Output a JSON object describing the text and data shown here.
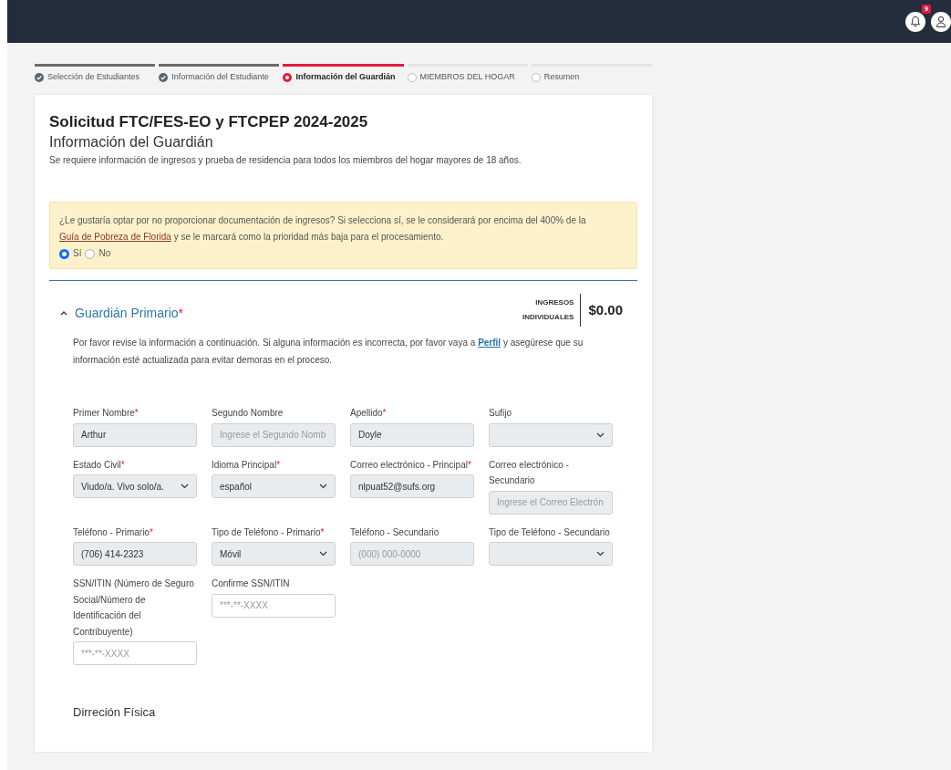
{
  "header": {
    "notification_count": "9"
  },
  "steps": [
    {
      "label": "Selección de Estudiantes",
      "completed": true,
      "selected": false
    },
    {
      "label": "Información del Estudiante",
      "completed": true,
      "selected": false
    },
    {
      "label": "Información del Guardián",
      "completed": false,
      "selected": true
    },
    {
      "label": "MIEMBROS DEL HOGAR",
      "completed": false,
      "selected": false
    },
    {
      "label": "Resumen",
      "completed": false,
      "selected": false
    }
  ],
  "form": {
    "title": "Solicitud FTC/FES-EO y FTCPEP 2024-2025",
    "subtitle": "Información del Guardián",
    "intro": "Se requiere información de ingresos y prueba de residencia para todos los miembros del hogar mayores de 18 años."
  },
  "alert": {
    "text_before": "¿Le gustaría optar por no proporcionar documentación de ingresos? Si selecciona sí, se le considerará por encima del 400% de la ",
    "link": "Guía de Pobreza de Florida",
    "text_after": " y se le marcará como la prioridad más baja para el procesamiento.",
    "options": [
      {
        "label": "Sí",
        "selected": true
      },
      {
        "label": "No",
        "selected": false
      }
    ]
  },
  "section": {
    "title": "Guardián Primario",
    "required_mark": "*",
    "expanded": true,
    "income_label": "INGRESOS INDIVIDUALES",
    "income_value": "$0.00",
    "notice_before": "Por favor revise la información a continuación. Si alguna información es incorrecta, por favor vaya a ",
    "notice_link": "Perfil",
    "notice_after": " y asegúrese que su información esté actualizada para evitar demoras en el proceso.",
    "field_rows": [
      [
        {
          "label": "Primer Nombre",
          "required_mark": "*",
          "kind": "text",
          "value": "Arthur",
          "disabled": true
        },
        {
          "label": "Segundo Nombre",
          "kind": "text",
          "placeholder": "Ingrese el Segundo Nomb",
          "disabled": true
        },
        {
          "label": "Apellido",
          "required_mark": "*",
          "kind": "text",
          "value": "Doyle",
          "disabled": true
        },
        {
          "label": "Sufijo",
          "kind": "select",
          "disabled": true
        }
      ],
      [
        {
          "label": "Estado Civil",
          "required_mark": "*",
          "kind": "select",
          "value": "Viudo/a. Vivo solo/a.",
          "disabled": true
        },
        {
          "label": "Idioma Principal",
          "required_mark": "*",
          "kind": "select",
          "value": "español",
          "disabled": true
        },
        {
          "label": "Correo electrónico - Principal",
          "required_mark": "*",
          "kind": "text",
          "value": "nlpuat52@sufs.org",
          "disabled": true
        },
        {
          "label": "Correo electrónico - Secundario",
          "kind": "text",
          "placeholder": "Ingrese el Correo Electrón",
          "disabled": true
        }
      ],
      [
        {
          "label": "Teléfono - Primario",
          "required_mark": "*",
          "kind": "text",
          "value": "(706) 414-2323",
          "disabled": true
        },
        {
          "label": "Tipo de Teléfono - Primario",
          "required_mark": "*",
          "kind": "select",
          "value": "Móvil",
          "disabled": true
        },
        {
          "label": "Teléfono - Secundario",
          "kind": "text",
          "placeholder": "(000) 000-0000",
          "disabled": true
        },
        {
          "label": "Tipo de Teléfono - Secundario",
          "kind": "select",
          "disabled": true
        }
      ],
      [
        {
          "label": "SSN/ITIN (Número de Seguro Social/Número de Identificación del Contribuyente)",
          "kind": "text",
          "placeholder": "***-**-XXXX",
          "disabled": false
        },
        {
          "label": "Confirme SSN/ITIN",
          "kind": "text",
          "placeholder": "***-**-XXXX",
          "disabled": false
        }
      ]
    ],
    "address_heading": "Dirreción Física"
  }
}
